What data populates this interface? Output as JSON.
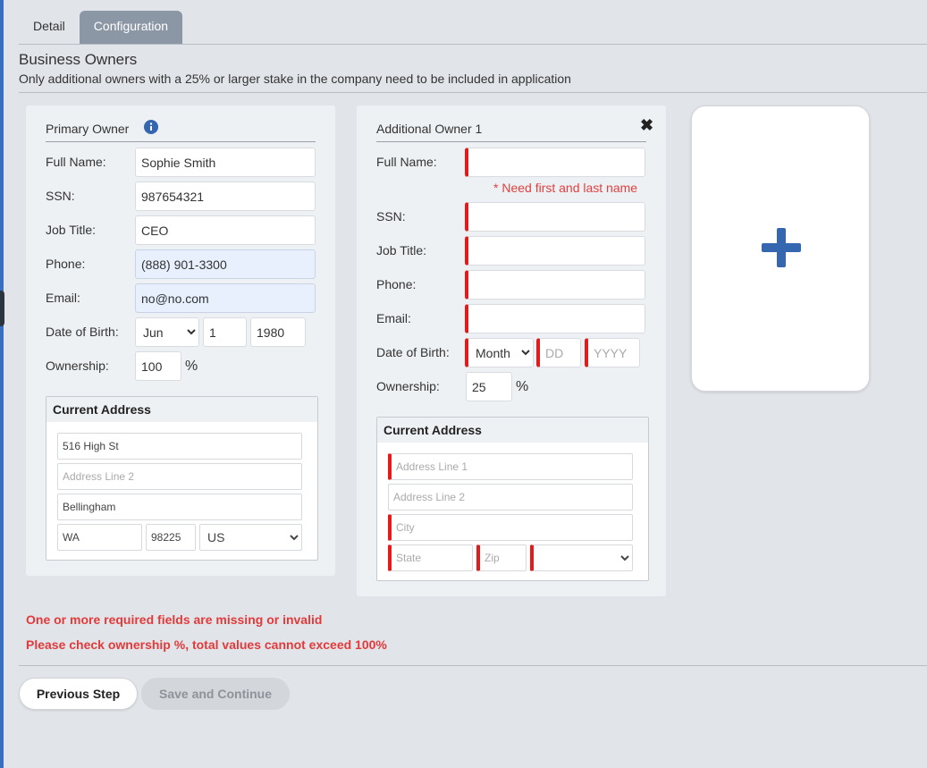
{
  "tabs": [
    {
      "label": "Detail",
      "active": false
    },
    {
      "label": "Configuration",
      "active": true
    }
  ],
  "section": {
    "title": "Business Owners",
    "subtitle": "Only additional owners with a 25% or larger stake in the company need to be included in application"
  },
  "labels": {
    "full_name": "Full Name:",
    "ssn": "SSN:",
    "job_title": "Job Title:",
    "phone": "Phone:",
    "email": "Email:",
    "dob": "Date of Birth:",
    "ownership": "Ownership:",
    "percent": "%",
    "current_address": "Current Address"
  },
  "primary_owner": {
    "title": "Primary Owner",
    "info_icon": "info-circle-icon",
    "full_name": "Sophie Smith",
    "ssn": "987654321",
    "job_title": "CEO",
    "phone": "(888) 901-3300",
    "email": "no@no.com",
    "dob_month": "Jun",
    "dob_day": "1",
    "dob_year": "1980",
    "ownership": "100",
    "address": {
      "line1": "516 High St",
      "line2": "",
      "line2_placeholder": "Address Line 2",
      "city": "Bellingham",
      "state": "WA",
      "zip": "98225",
      "country": "US"
    }
  },
  "additional_owner": {
    "title": "Additional Owner 1",
    "close_icon": "close-icon",
    "full_name": "",
    "name_error": "* Need first and last name",
    "ssn": "",
    "job_title": "",
    "phone": "",
    "email": "",
    "dob_month": "Month",
    "dob_day_placeholder": "DD",
    "dob_year_placeholder": "YYYY",
    "ownership": "25",
    "address": {
      "line1_placeholder": "Address Line 1",
      "line2_placeholder": "Address Line 2",
      "city_placeholder": "City",
      "state_placeholder": "State",
      "zip_placeholder": "Zip",
      "country": ""
    }
  },
  "add_owner": {
    "icon": "plus-icon",
    "color": "#3566b0"
  },
  "errors": {
    "missing_fields": "One or more required fields are missing or invalid",
    "ownership": "Please check ownership %, total values cannot exceed 100%"
  },
  "buttons": {
    "previous": "Previous Step",
    "save": "Save and Continue"
  },
  "colors": {
    "accent": "#3566b0",
    "error": "#e23a3a",
    "required_marker": "#e41b1b",
    "active_tab": "#8c97a6"
  }
}
